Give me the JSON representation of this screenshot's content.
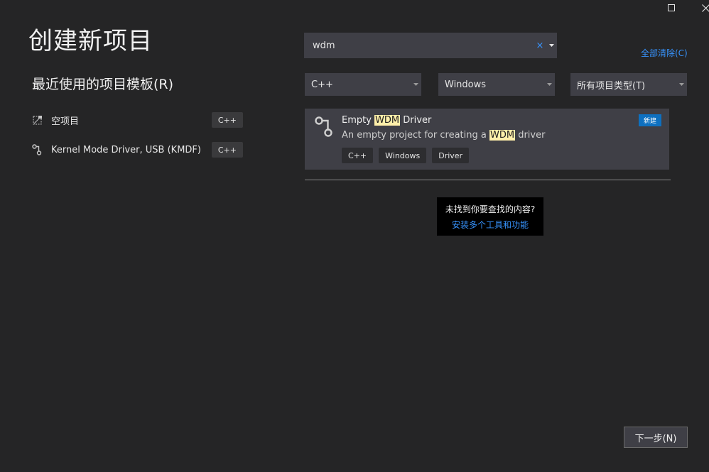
{
  "window": {
    "maximize_icon": "maximize-icon",
    "close_icon": "close-icon"
  },
  "page": {
    "title": "创建新项目"
  },
  "recent": {
    "title": "最近使用的项目模板(R)",
    "items": [
      {
        "label": "空项目",
        "tag": "C++",
        "icon": "empty-project-icon"
      },
      {
        "label": "Kernel Mode Driver, USB (KMDF)",
        "tag": "C++",
        "icon": "driver-icon"
      }
    ]
  },
  "search": {
    "value": "wdm",
    "clear_glyph": "×",
    "dropdown_icon": "chevron-down-icon"
  },
  "clear_all": "全部清除(C)",
  "filters": {
    "language": "C++",
    "platform": "Windows",
    "project_type": "所有项目类型(T)"
  },
  "results": [
    {
      "name_pre": "Empty ",
      "name_hl": "WDM",
      "name_post": " Driver",
      "desc_pre": "An empty project for creating a ",
      "desc_hl": "WDM",
      "desc_post": " driver",
      "badge": "新建",
      "tags": [
        "C++",
        "Windows",
        "Driver"
      ],
      "icon": "driver-icon"
    }
  ],
  "not_found": {
    "question": "未找到你要查找的内容?",
    "link": "安装多个工具和功能"
  },
  "footer": {
    "next_label": "下一步(N)"
  },
  "colors": {
    "background": "#252526",
    "panel": "#3f3f46",
    "accent": "#3794ff",
    "badge": "#0e70c0",
    "highlight": "#ffefaa"
  }
}
